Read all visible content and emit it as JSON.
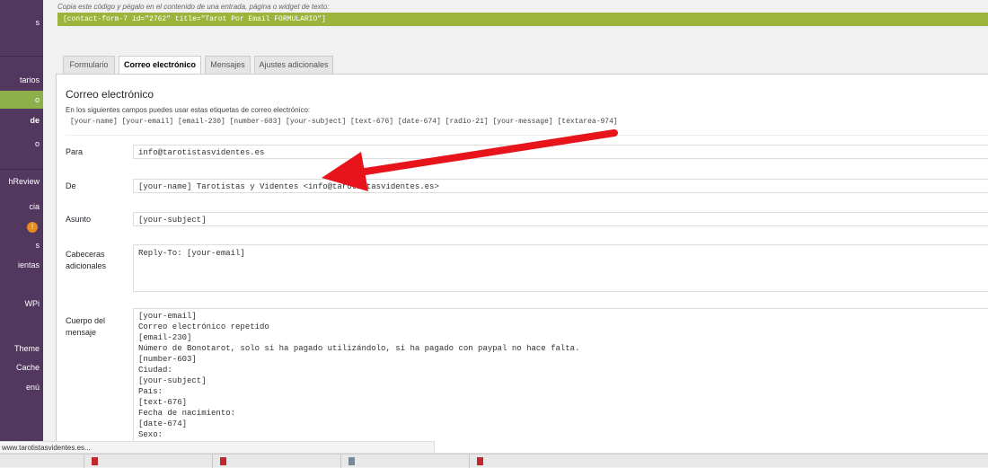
{
  "sidebar": {
    "items": [
      {
        "label": "s"
      },
      {
        "label": "tarios"
      },
      {
        "label": "o"
      },
      {
        "label": "de"
      },
      {
        "label": "o"
      },
      {
        "label": "hReview"
      },
      {
        "label": "cia"
      },
      {
        "label": "s"
      },
      {
        "label": "ientas"
      },
      {
        "label": "WPi"
      },
      {
        "label": "Theme"
      },
      {
        "label": "Cache"
      },
      {
        "label": "enú"
      }
    ],
    "badge": "!"
  },
  "shortcode": {
    "hint": "Copia este código y pégalo en el contenido de una entrada, página o widget de texto:",
    "code": "[contact-form-7 id=\"2762\" title=\"Tarot Por Email FORMULARIO\"]"
  },
  "tabs": [
    {
      "label": "Formulario"
    },
    {
      "label": "Correo electrónico"
    },
    {
      "label": "Mensajes"
    },
    {
      "label": "Ajustes adicionales"
    }
  ],
  "panel": {
    "title": "Correo electrónico",
    "tags_intro": "En los siguientes campos puedes usar estas etiquetas de correo electrónico:",
    "tags": "[your-name] [your-email] [email-230] [number-603] [your-subject] [text-676] [date-674] [radio-21] [your-message] [textarea-974]"
  },
  "fields": {
    "to": {
      "label": "Para",
      "value": "info@tarotistasvidentes.es"
    },
    "from": {
      "label": "De",
      "value": "[your-name] Tarotistas y Videntes <info@tarotistasvidentes.es>"
    },
    "subject": {
      "label": "Asunto",
      "value": "[your-subject]"
    },
    "headers": {
      "label": "Cabeceras adicionales",
      "value": "Reply-To: [your-email]"
    },
    "body": {
      "label": "Cuerpo del mensaje",
      "value": "[your-email]\nCorreo electrónico repetido\n[email-230]\nNúmero de Bonotarot, solo si ha pagado utilizándolo, si ha pagado con paypal no hace falta.\n[number-603]\nCiudad:\n[your-subject]\nPaís:\n[text-676]\nFecha de nacimiento:\n[date-674]\nSexo:"
    }
  },
  "status_bar": {
    "url": "www.tarotistasvidentes.es..."
  },
  "colors": {
    "sidebar_bg": "#52375f",
    "active_item": "#8eb04a",
    "shortcode_bar": "#9cb43c",
    "arrow": "#e8141b"
  }
}
